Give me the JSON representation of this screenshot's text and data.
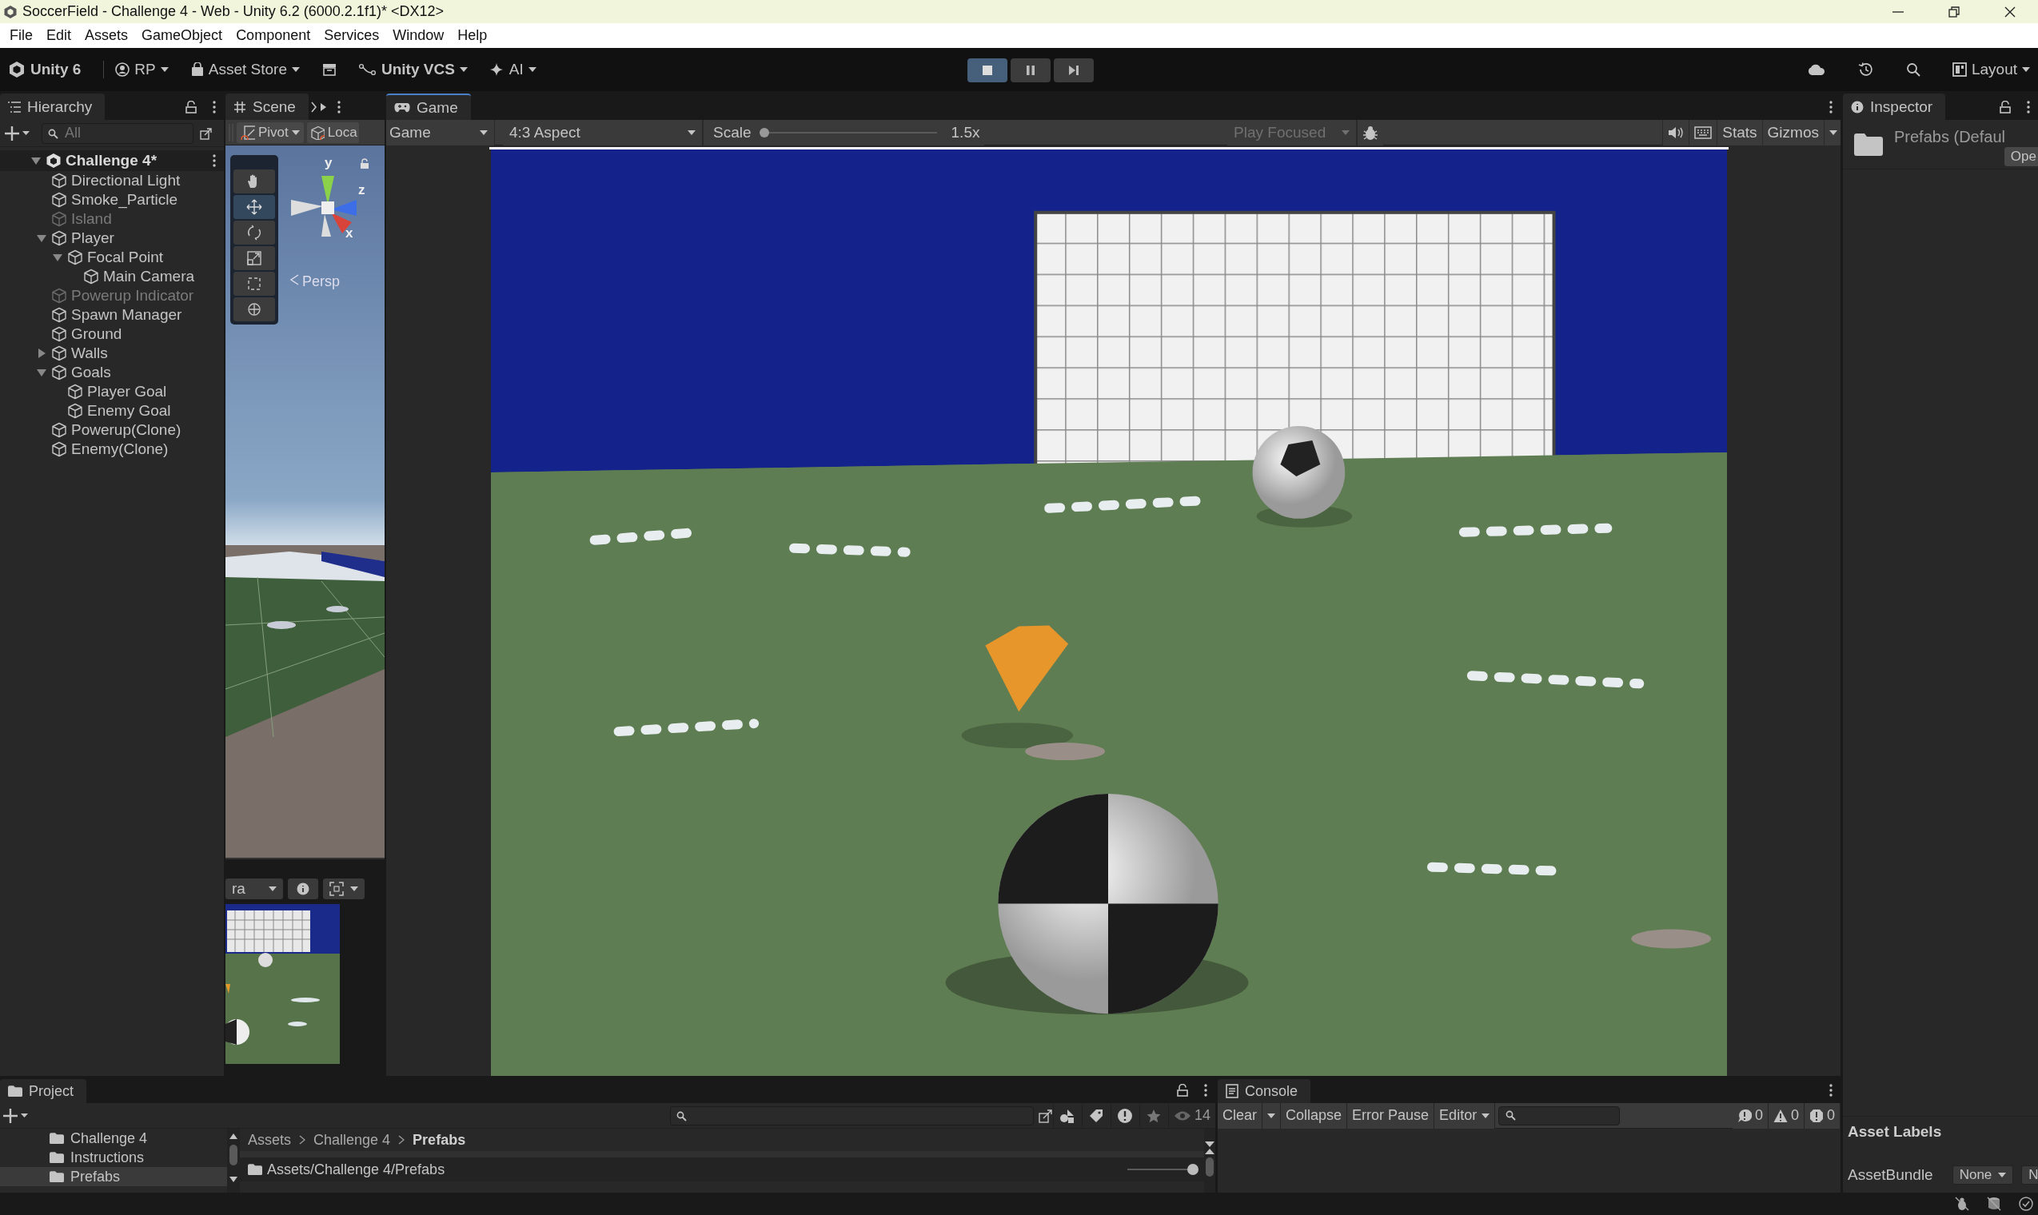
{
  "window": {
    "title": "SoccerField - Challenge 4 - Web - Unity 6.2 (6000.2.1f1)* <DX12>"
  },
  "menu": [
    "File",
    "Edit",
    "Assets",
    "GameObject",
    "Component",
    "Services",
    "Window",
    "Help"
  ],
  "toolbar": {
    "account": "Unity 6",
    "rp": "RP",
    "asset_store": "Asset Store",
    "vcs": "Unity VCS",
    "ai": "AI",
    "layout": "Layout",
    "play_controls": [
      {
        "kind": "play",
        "selected": true
      },
      {
        "kind": "pause",
        "selected": false
      },
      {
        "kind": "step",
        "selected": false
      }
    ]
  },
  "hierarchy": {
    "tab": "Hierarchy",
    "search_placeholder": "All",
    "scene": {
      "label": "Challenge 4*",
      "expanded": true,
      "children": [
        {
          "label": "Directional Light",
          "active": true
        },
        {
          "label": "Smoke_Particle",
          "active": true
        },
        {
          "label": "Island",
          "active": false
        },
        {
          "label": "Player",
          "active": true,
          "expanded": true,
          "children": [
            {
              "label": "Focal Point",
              "active": true,
              "expanded": true,
              "children": [
                {
                  "label": "Main Camera",
                  "active": true
                }
              ]
            }
          ]
        },
        {
          "label": "Powerup Indicator",
          "active": false
        },
        {
          "label": "Spawn Manager",
          "active": true
        },
        {
          "label": "Ground",
          "active": true
        },
        {
          "label": "Walls",
          "active": true,
          "expanded": false
        },
        {
          "label": "Goals",
          "active": true,
          "expanded": true,
          "children": [
            {
              "label": "Player Goal",
              "active": true
            },
            {
              "label": "Enemy Goal",
              "active": true
            }
          ]
        },
        {
          "label": "Powerup(Clone)",
          "active": true
        },
        {
          "label": "Enemy(Clone)",
          "active": true
        }
      ]
    }
  },
  "scene_view": {
    "tab": "Scene",
    "pivot": "Pivot",
    "local": "Loca",
    "persp": "Persp",
    "axes": [
      "y",
      "z",
      "x"
    ],
    "tools": [
      {
        "kind": "hand",
        "selected": false
      },
      {
        "kind": "move",
        "selected": true
      },
      {
        "kind": "rotate",
        "selected": false
      },
      {
        "kind": "scale",
        "selected": false
      },
      {
        "kind": "rect",
        "selected": false
      },
      {
        "kind": "transform",
        "selected": false
      }
    ],
    "preview_camera": "ra"
  },
  "game_view": {
    "tab": "Game",
    "display": "Game",
    "aspect": "4:3 Aspect",
    "scale_label": "Scale",
    "scale": {
      "level": 0.02
    },
    "scale_value": "1.5x",
    "play_focused": "Play Focused",
    "stats": "Stats",
    "gizmos": "Gizmos"
  },
  "inspector": {
    "tab": "Inspector",
    "title": "Prefabs (Defaul",
    "open_button": "Ope",
    "asset_labels": "Asset Labels",
    "asset_bundle_label": "AssetBundle",
    "asset_bundle": "None",
    "asset_variant": "N"
  },
  "project": {
    "tab": "Project",
    "folders": [
      {
        "label": "Challenge 4",
        "selected": false
      },
      {
        "label": "Instructions",
        "selected": false
      },
      {
        "label": "Prefabs",
        "selected": true
      }
    ],
    "breadcrumbs": [
      "Assets",
      "Challenge 4",
      "Prefabs"
    ],
    "hidden_count": "14",
    "path": "Assets/Challenge 4/Prefabs",
    "icon_size": {
      "level": 0.95
    }
  },
  "console": {
    "tab": "Console",
    "clear": "Clear",
    "collapse": "Collapse",
    "error_pause": "Error Pause",
    "editor": "Editor",
    "counts": [
      {
        "kind": "info",
        "count": "0"
      },
      {
        "kind": "warning",
        "count": "0"
      },
      {
        "kind": "error",
        "count": "0"
      }
    ]
  }
}
